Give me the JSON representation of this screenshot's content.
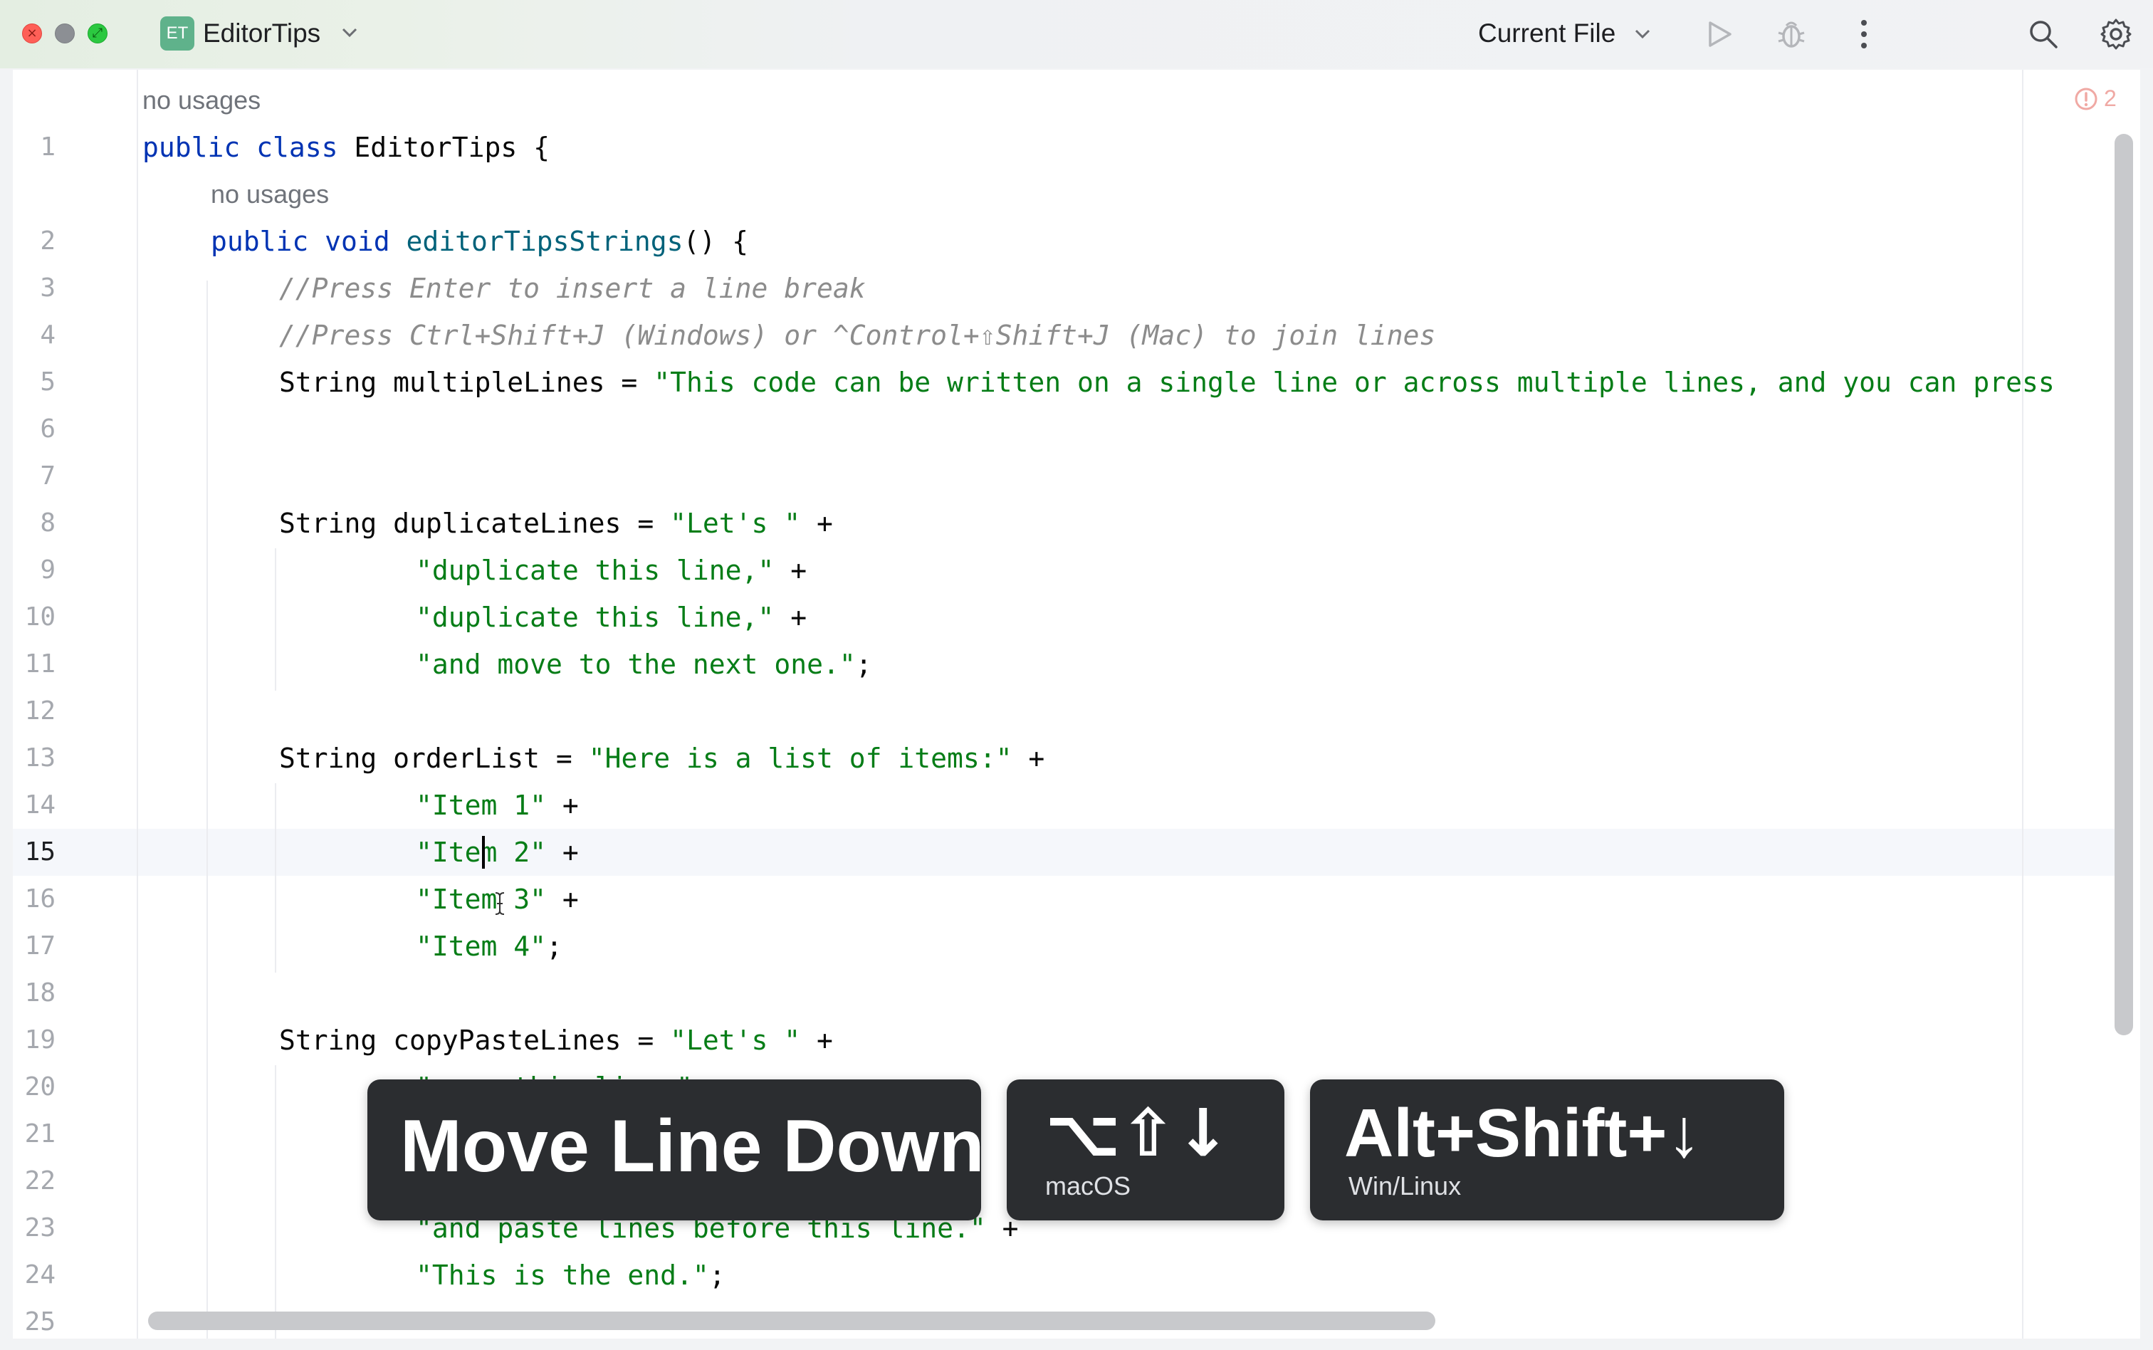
{
  "titlebar": {
    "project_badge": "ET",
    "project_name": "EditorTips",
    "run_config": "Current File",
    "icons": [
      "run-icon",
      "debug-icon",
      "more-icon",
      "search-icon",
      "settings-icon"
    ]
  },
  "editor": {
    "inspection_count": "2",
    "usage_hint_class": "no usages",
    "usage_hint_method": "no usages",
    "line_numbers": [
      "1",
      "2",
      "3",
      "4",
      "5",
      "6",
      "7",
      "8",
      "9",
      "10",
      "11",
      "12",
      "13",
      "14",
      "15",
      "16",
      "17",
      "18",
      "19",
      "20",
      "21",
      "22",
      "23",
      "24",
      "25"
    ],
    "current_line": "15",
    "lines": {
      "l1": {
        "kw": "public class ",
        "name": "EditorTips {"
      },
      "l2": {
        "kw": "public void ",
        "fn": "editorTipsStrings",
        "rest": "() {"
      },
      "l3": "//Press Enter to insert a line break",
      "l4": "//Press Ctrl+Shift+J (Windows) or ^Control+⇧Shift+J (Mac) to join lines",
      "l5": {
        "decl": "String multipleLines = ",
        "str": "\"This code can be written on a single line or across multiple lines, and you can press"
      },
      "l8": {
        "decl": "String duplicateLines = ",
        "str": "\"Let's \"",
        "op": " +"
      },
      "l9": {
        "str": "\"duplicate this line,\"",
        "op": " +"
      },
      "l10": {
        "str": "\"duplicate this line,\"",
        "op": " +"
      },
      "l11": {
        "str": "\"and move to the next one.\"",
        "op": ";"
      },
      "l13": {
        "decl": "String orderList = ",
        "str": "\"Here is a list of items:\"",
        "op": " +"
      },
      "l14": {
        "str": "\"Item 1\"",
        "op": " +"
      },
      "l15": {
        "str": "\"Item 2\"",
        "op": " +"
      },
      "l16": {
        "str": "\"Item 3\"",
        "op": " +"
      },
      "l17": {
        "str": "\"Item 4\"",
        "op": ";"
      },
      "l19": {
        "decl": "String copyPasteLines = ",
        "str": "\"Let's \"",
        "op": " +"
      },
      "l20": {
        "str": "\"copy this line,\""
      },
      "l23": {
        "str": "\"and paste lines before this line.\"",
        "op": " +"
      },
      "l24": {
        "str": "\"This is the end.\"",
        "op": ";"
      }
    }
  },
  "keystroke_overlay": {
    "action": "Move Line Down",
    "mac_keys": "⌥⇧↓",
    "mac_label": "macOS",
    "win_keys": "Alt+Shift+↓",
    "win_label": "Win/Linux"
  },
  "colors": {
    "keyword": "#0033b3",
    "method": "#00627a",
    "string": "#067d17",
    "comment": "#8c8c8c",
    "overlay_bg": "#2b2d30"
  }
}
